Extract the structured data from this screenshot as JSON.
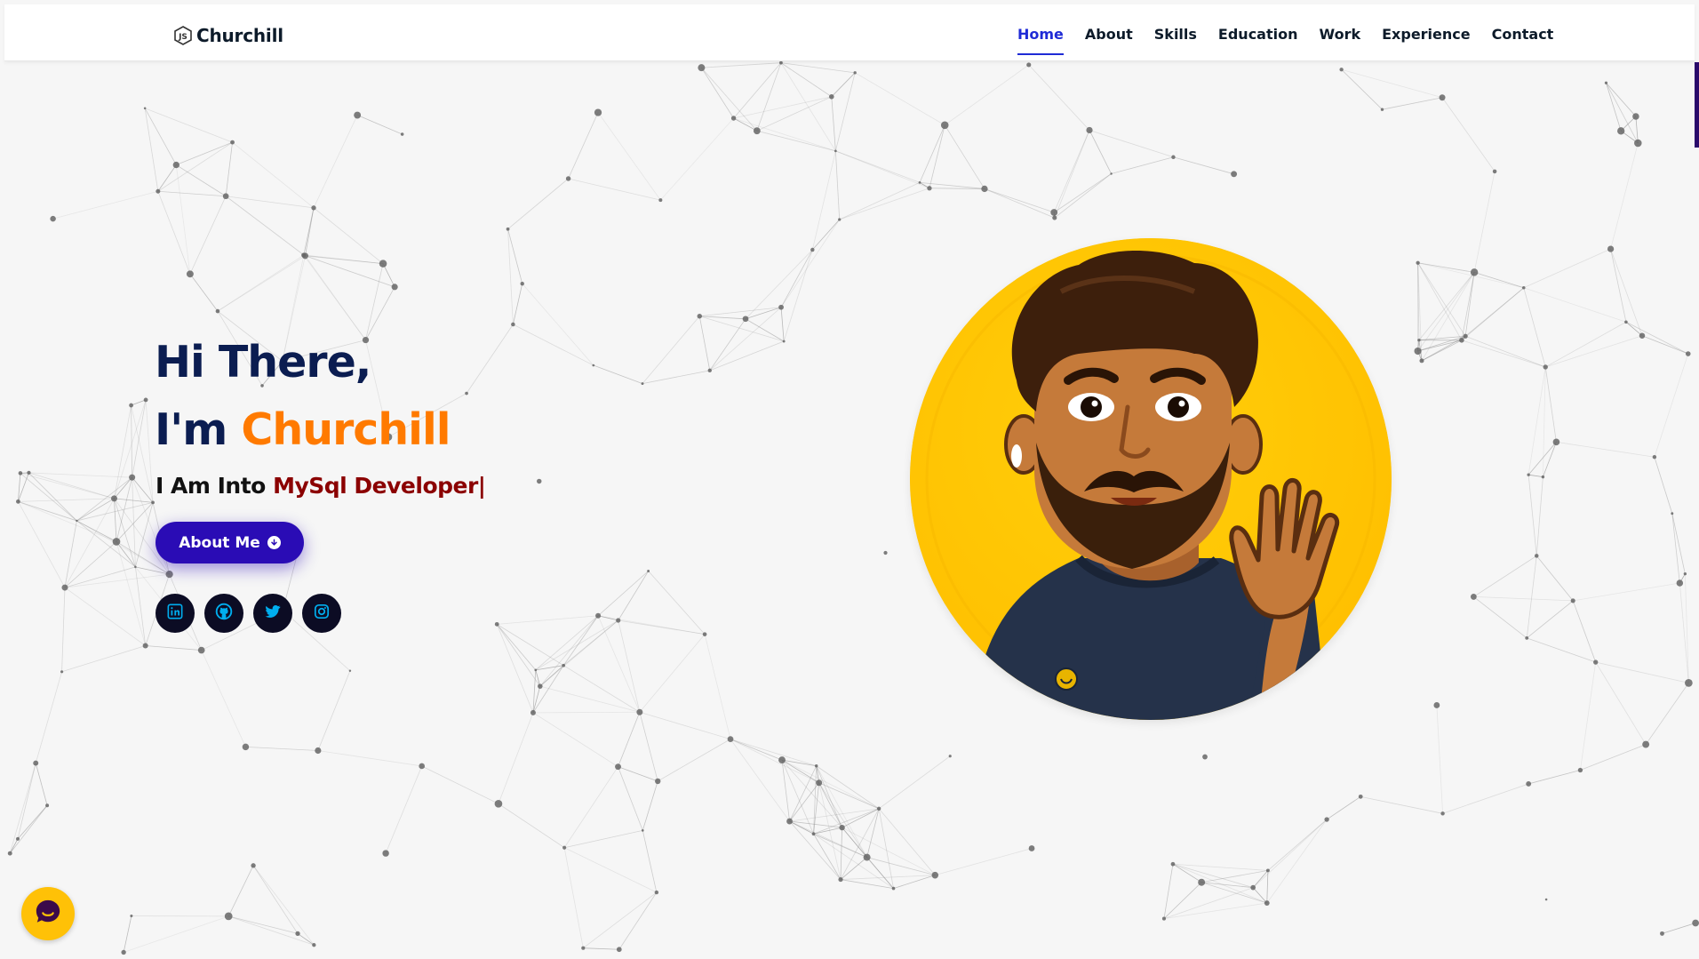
{
  "header": {
    "brand": "Churchill",
    "brand_icon": "javascript-hexagon-icon",
    "nav": [
      {
        "label": "Home",
        "active": true
      },
      {
        "label": "About",
        "active": false
      },
      {
        "label": "Skills",
        "active": false
      },
      {
        "label": "Education",
        "active": false
      },
      {
        "label": "Work",
        "active": false
      },
      {
        "label": "Experience",
        "active": false
      },
      {
        "label": "Contact",
        "active": false
      }
    ]
  },
  "hero": {
    "greeting": "Hi There,",
    "intro_prefix": "I'm",
    "name": "Churchill",
    "typed_prefix": "I Am Into",
    "typed_role": "MySql Developer|",
    "cta_label": "About Me",
    "cta_icon": "arrow-down-circle-icon"
  },
  "socials": [
    {
      "icon": "linkedin-icon"
    },
    {
      "icon": "github-icon"
    },
    {
      "icon": "twitter-icon"
    },
    {
      "icon": "instagram-icon"
    }
  ],
  "chat": {
    "icon": "chat-bubble-icon"
  },
  "colors": {
    "nav_active": "#1f2bd6",
    "heading": "#0b1d51",
    "accent_name": "#ff7a00",
    "role_text": "#8b0000",
    "button_bg": "#2a0cb5",
    "social_bg": "#0c0c24",
    "social_icon": "#00aeef",
    "avatar_bg": "#ffc200",
    "chat_bg": "#ffc107"
  }
}
